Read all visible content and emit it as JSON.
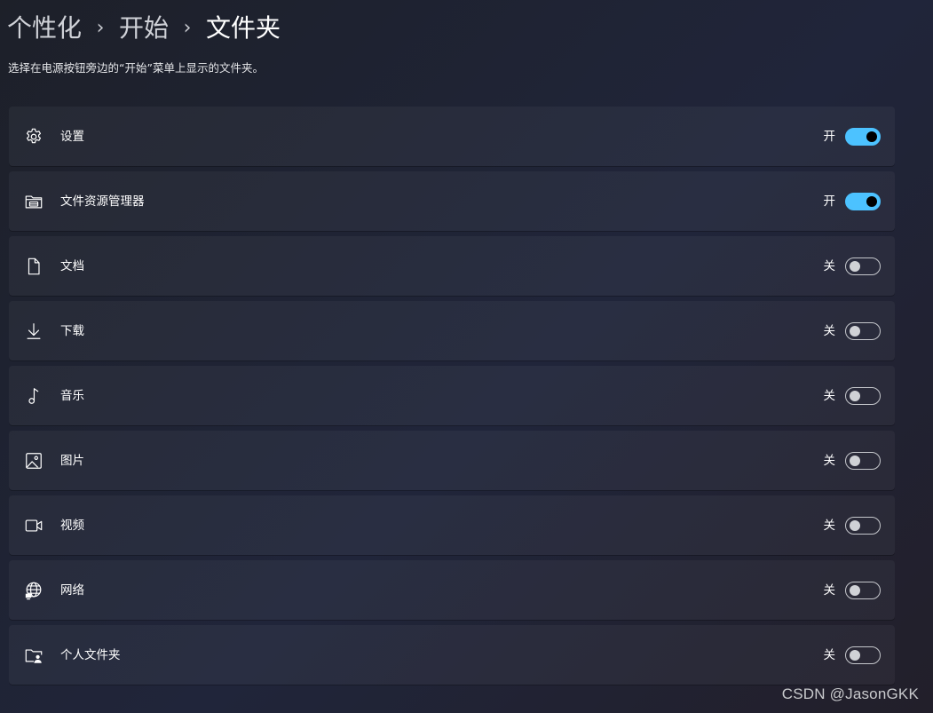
{
  "breadcrumb": {
    "items": [
      "个性化",
      "开始"
    ],
    "separator": "›",
    "current": "文件夹"
  },
  "description": "选择在电源按钮旁边的“开始”菜单上显示的文件夹。",
  "state_labels": {
    "on": "开",
    "off": "关"
  },
  "colors": {
    "accent": "#4cc2ff"
  },
  "folders": [
    {
      "label": "设置",
      "icon": "gear-icon",
      "on": true,
      "state_text": "开"
    },
    {
      "label": "文件资源管理器",
      "icon": "file-explorer-icon",
      "on": true,
      "state_text": "开"
    },
    {
      "label": "文档",
      "icon": "document-icon",
      "on": false,
      "state_text": "关"
    },
    {
      "label": "下载",
      "icon": "download-icon",
      "on": false,
      "state_text": "关"
    },
    {
      "label": "音乐",
      "icon": "music-icon",
      "on": false,
      "state_text": "关"
    },
    {
      "label": "图片",
      "icon": "picture-icon",
      "on": false,
      "state_text": "关"
    },
    {
      "label": "视频",
      "icon": "video-icon",
      "on": false,
      "state_text": "关"
    },
    {
      "label": "网络",
      "icon": "network-icon",
      "on": false,
      "state_text": "关"
    },
    {
      "label": "个人文件夹",
      "icon": "personal-folder-icon",
      "on": false,
      "state_text": "关"
    }
  ],
  "watermark": "CSDN @JasonGKK"
}
